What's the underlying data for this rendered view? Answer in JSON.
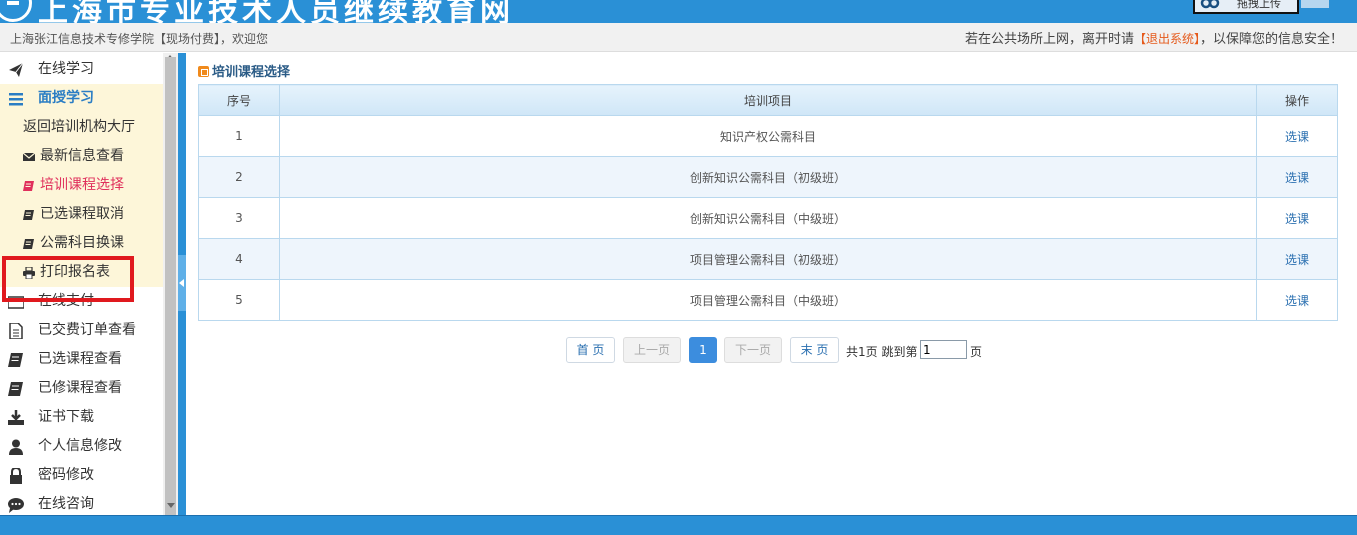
{
  "header": {
    "site_title": "上海市专业技术人员继续教育网",
    "upload_button": "拖拽上传"
  },
  "info_bar": {
    "welcome": "上海张江信息技术专修学院【现场付费】，欢迎您",
    "security_prefix": "若在公共场所上网，离开时请",
    "logout": "【退出系统】",
    "security_suffix": "，以保障您的信息安全！"
  },
  "sidebar": {
    "online_study": "在线学习",
    "face_study": "面授学习",
    "sub_items": [
      {
        "label": "返回培训机构大厅",
        "icon": ""
      },
      {
        "label": "最新信息查看",
        "icon": "envelope-icon"
      },
      {
        "label": "培训课程选择",
        "icon": "book-icon"
      },
      {
        "label": "已选课程取消",
        "icon": "book-icon"
      },
      {
        "label": "公需科目换课",
        "icon": "book-icon"
      },
      {
        "label": "打印报名表",
        "icon": "print-icon"
      }
    ],
    "items": [
      {
        "label": "在线支付",
        "icon": "credit-card-icon"
      },
      {
        "label": "已交费订单查看",
        "icon": "document-icon"
      },
      {
        "label": "已选课程查看",
        "icon": "book-icon"
      },
      {
        "label": "已修课程查看",
        "icon": "book-icon"
      },
      {
        "label": "证书下载",
        "icon": "download-icon"
      },
      {
        "label": "个人信息修改",
        "icon": "user-icon"
      },
      {
        "label": "密码修改",
        "icon": "lock-icon"
      },
      {
        "label": "在线咨询",
        "icon": "chat-icon"
      }
    ]
  },
  "main": {
    "section_title": "培训课程选择",
    "table": {
      "headers": [
        "序号",
        "培训项目",
        "操作"
      ],
      "rows": [
        {
          "no": "1",
          "project": "知识产权公需科目",
          "action": "选课"
        },
        {
          "no": "2",
          "project": "创新知识公需科目（初级班）",
          "action": "选课"
        },
        {
          "no": "3",
          "project": "创新知识公需科目（中级班）",
          "action": "选课"
        },
        {
          "no": "4",
          "project": "项目管理公需科目（初级班）",
          "action": "选课"
        },
        {
          "no": "5",
          "project": "项目管理公需科目（中级班）",
          "action": "选课"
        }
      ]
    },
    "pager": {
      "first": "首 页",
      "prev": "上一页",
      "current": "1",
      "next": "下一页",
      "last": "末 页",
      "summary": "共1页 跳到第",
      "page_input": "1",
      "page_unit": "页"
    }
  },
  "colors": {
    "brand_blue": "#2a90d6",
    "active_item": "#e0305c",
    "logout": "#e55a1c",
    "highlight": "#e0191e"
  }
}
